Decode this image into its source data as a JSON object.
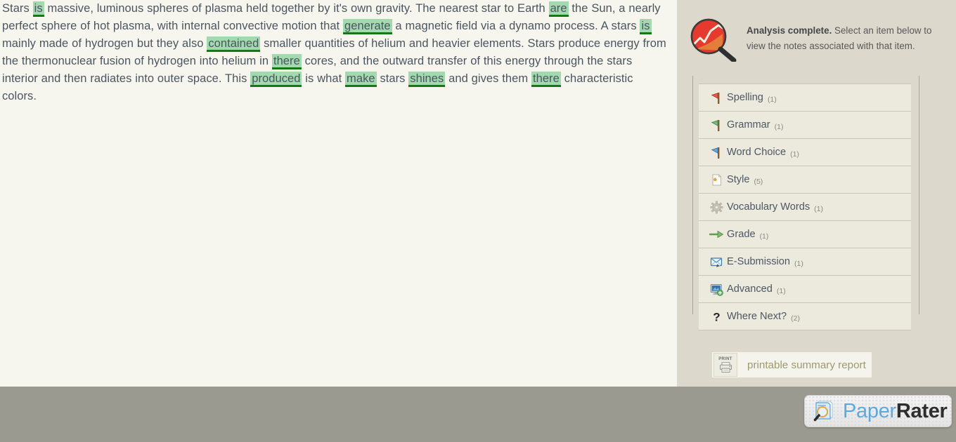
{
  "editor": {
    "segments": [
      {
        "t": "Stars ",
        "h": false
      },
      {
        "t": "is",
        "h": true
      },
      {
        "t": " massive, luminous spheres of plasma held together by it's own gravity. The nearest star to Earth ",
        "h": false
      },
      {
        "t": "are",
        "h": true
      },
      {
        "t": " the Sun, a nearly perfect sphere of hot plasma, with internal convective motion that ",
        "h": false
      },
      {
        "t": "generate",
        "h": true
      },
      {
        "t": " a magnetic field via a dynamo process. A stars ",
        "h": false
      },
      {
        "t": "is",
        "h": true
      },
      {
        "t": " mainly made of hydrogen but they also ",
        "h": false
      },
      {
        "t": "contained",
        "h": true
      },
      {
        "t": " smaller quantities of helium and heavier elements. Stars produce energy from the thermonuclear fusion of hydrogen into helium in ",
        "h": false
      },
      {
        "t": "there",
        "h": true
      },
      {
        "t": " cores, and the outward transfer of this energy through the stars interior and then radiates into outer space. This ",
        "h": false
      },
      {
        "t": "produced",
        "h": true
      },
      {
        "t": " is what ",
        "h": false
      },
      {
        "t": "make",
        "h": true
      },
      {
        "t": " stars ",
        "h": false
      },
      {
        "t": "shines",
        "h": true
      },
      {
        "t": " and gives them ",
        "h": false
      },
      {
        "t": "there",
        "h": true
      },
      {
        "t": " characteristic colors.",
        "h": false
      }
    ],
    "highlight_color": "#a3d9ae",
    "highlight_underline_color": "#137a13",
    "text_color": "#4b5560",
    "background": "#f7f6ee"
  },
  "sidebar": {
    "background": "#dcd8cb",
    "banner": {
      "icon": "magnifier-chart-icon",
      "strong_text": "Analysis complete.",
      "text": " Select an item below to view the notes associated with that item."
    },
    "items": [
      {
        "label": "Spelling",
        "count": "(1)",
        "icon": "red-flag-icon"
      },
      {
        "label": "Grammar",
        "count": "(1)",
        "icon": "green-flag-icon"
      },
      {
        "label": "Word Choice",
        "count": "(1)",
        "icon": "blue-flag-icon"
      },
      {
        "label": "Style",
        "count": "(5)",
        "icon": "page-star-icon"
      },
      {
        "label": "Vocabulary Words",
        "count": "(1)",
        "icon": "gear-icon"
      },
      {
        "label": "Grade",
        "count": "(1)",
        "icon": "green-arrow-icon"
      },
      {
        "label": "E-Submission",
        "count": "(1)",
        "icon": "envelope-pencil-icon"
      },
      {
        "label": "Advanced",
        "count": "(1)",
        "icon": "monitor-plus-icon"
      },
      {
        "label": "Where Next?",
        "count": "(2)",
        "icon": "question-mark-icon"
      }
    ],
    "print_report": {
      "icon_word": "PRINT",
      "label": "printable summary report"
    }
  },
  "footer": {
    "background": "#9a9a90",
    "brand": {
      "part1": "Paper",
      "part2": "Rater",
      "part1_color": "#5aa9e0",
      "part2_color": "#2d2d2d",
      "icon": "paper-magnifier-icon"
    }
  }
}
